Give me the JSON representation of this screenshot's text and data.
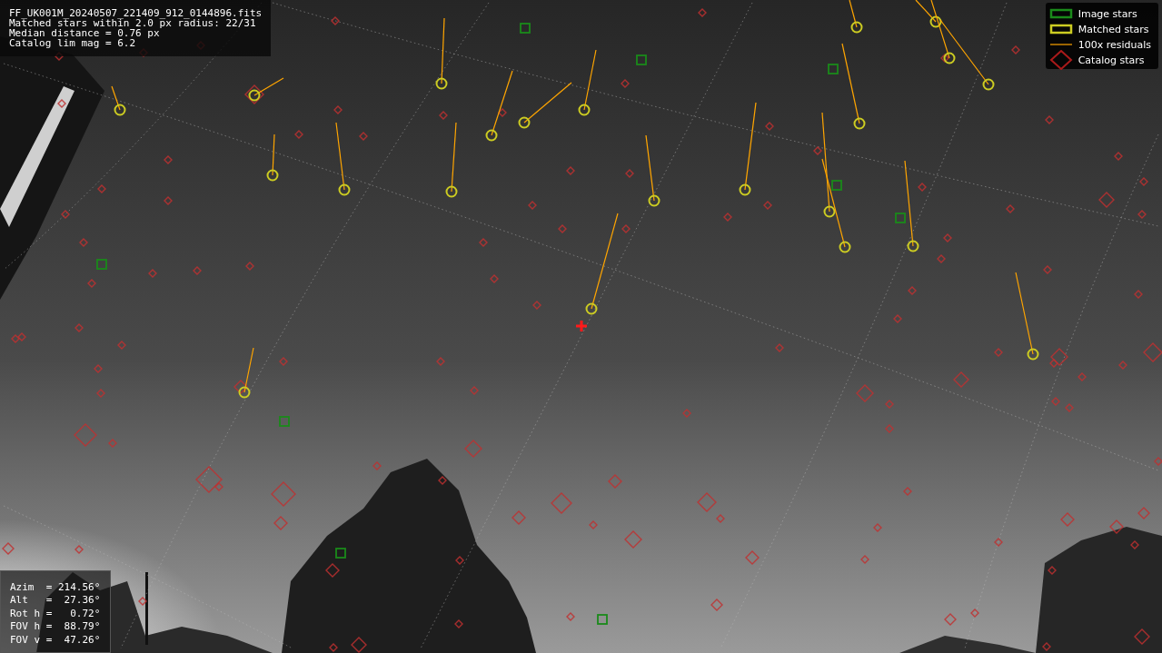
{
  "info_panel": {
    "lines": [
      "FF_UK001M_20240507_221409_912_0144896.fits",
      "Matched stars within 2.0 px radius: 22/31",
      "Median distance = 0.76 px",
      "Catalog lim mag = 6.2"
    ]
  },
  "legend": {
    "items": [
      {
        "label": "Image stars"
      },
      {
        "kind": "matched",
        "label": "Matched stars"
      },
      {
        "kind": "residual",
        "label": "100x residuals"
      },
      {
        "kind": "catalog",
        "label": "Catalog stars"
      }
    ]
  },
  "pointing_panel": {
    "lines": [
      "Azim  = 214.56°",
      "Alt   =  27.36°",
      "Rot h =   0.72°",
      "FOV h =  88.79°",
      "FOV v =  47.26°"
    ]
  }
}
